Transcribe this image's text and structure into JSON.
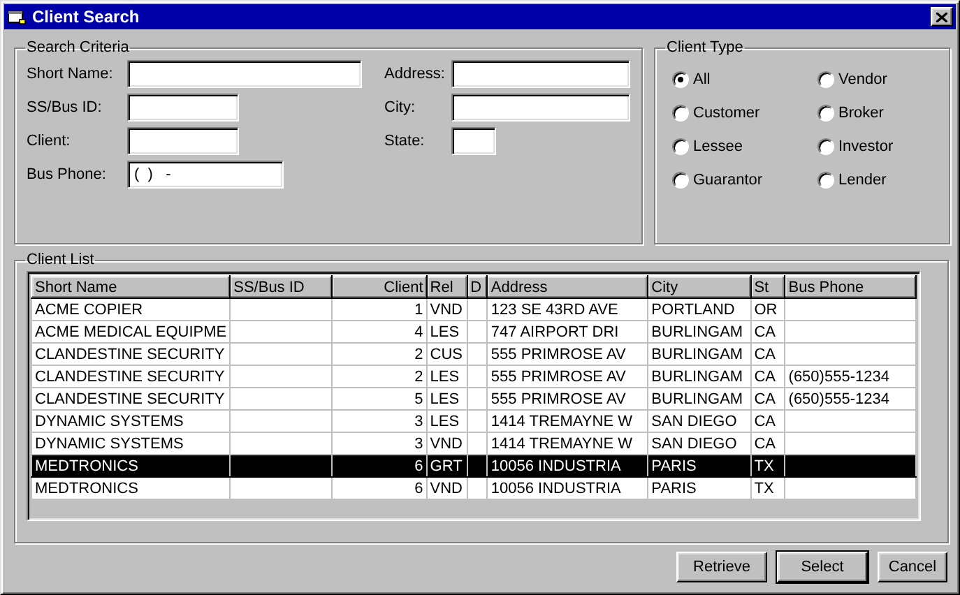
{
  "window": {
    "title": "Client Search"
  },
  "search_criteria": {
    "title": "Search Criteria",
    "left_fields": [
      {
        "label": "Short Name:"
      },
      {
        "label": "SS/Bus ID:"
      },
      {
        "label": "Client:"
      },
      {
        "label": "Bus Phone:",
        "value": "(  )   -"
      }
    ],
    "right_fields": [
      {
        "label": "Address:"
      },
      {
        "label": "City:"
      },
      {
        "label": "State:"
      }
    ]
  },
  "client_type": {
    "title": "Client Type",
    "options": [
      {
        "label": "All",
        "selected": true
      },
      {
        "label": "Vendor",
        "selected": false
      },
      {
        "label": "Customer",
        "selected": false
      },
      {
        "label": "Broker",
        "selected": false
      },
      {
        "label": "Lessee",
        "selected": false
      },
      {
        "label": "Investor",
        "selected": false
      },
      {
        "label": "Guarantor",
        "selected": false
      },
      {
        "label": "Lender",
        "selected": false
      }
    ]
  },
  "client_list": {
    "title": "Client List",
    "columns": [
      "Short Name",
      "SS/Bus ID",
      "Client",
      "Rel",
      "D",
      "Address",
      "City",
      "St",
      "Bus Phone"
    ],
    "rows": [
      {
        "short_name": "ACME COPIER",
        "client": "1",
        "rel": "VND",
        "address": "123 SE 43RD AVE",
        "city": "PORTLAND",
        "st": "OR",
        "selected": false
      },
      {
        "short_name": "ACME MEDICAL EQUIPME",
        "client": "4",
        "rel": "LES",
        "address": "747 AIRPORT DRI",
        "city": "BURLINGAM",
        "st": "CA",
        "selected": false
      },
      {
        "short_name": "CLANDESTINE SECURITY",
        "client": "2",
        "rel": "CUS",
        "address": "555 PRIMROSE AV",
        "city": "BURLINGAM",
        "st": "CA",
        "selected": false
      },
      {
        "short_name": "CLANDESTINE SECURITY",
        "client": "2",
        "rel": "LES",
        "address": "555 PRIMROSE AV",
        "city": "BURLINGAM",
        "st": "CA",
        "bus_phone": "(650)555-1234",
        "selected": false
      },
      {
        "short_name": "CLANDESTINE SECURITY",
        "client": "5",
        "rel": "LES",
        "address": "555 PRIMROSE AV",
        "city": "BURLINGAM",
        "st": "CA",
        "bus_phone": "(650)555-1234",
        "selected": false
      },
      {
        "short_name": "DYNAMIC SYSTEMS",
        "client": "3",
        "rel": "LES",
        "address": "1414 TREMAYNE W",
        "city": "SAN DIEGO",
        "st": "CA",
        "selected": false
      },
      {
        "short_name": "DYNAMIC SYSTEMS",
        "client": "3",
        "rel": "VND",
        "address": "1414 TREMAYNE W",
        "city": "SAN DIEGO",
        "st": "CA",
        "selected": false
      },
      {
        "short_name": "MEDTRONICS",
        "client": "6",
        "rel": "GRT",
        "address": "10056 INDUSTRIA",
        "city": "PARIS",
        "st": "TX",
        "selected": true
      },
      {
        "short_name": "MEDTRONICS",
        "client": "6",
        "rel": "VND",
        "address": "10056 INDUSTRIA",
        "city": "PARIS",
        "st": "TX",
        "selected": false
      }
    ]
  },
  "buttons": [
    {
      "label": "Retrieve",
      "default": false
    },
    {
      "label": "Select",
      "default": true
    },
    {
      "label": "Cancel",
      "default": false
    }
  ]
}
